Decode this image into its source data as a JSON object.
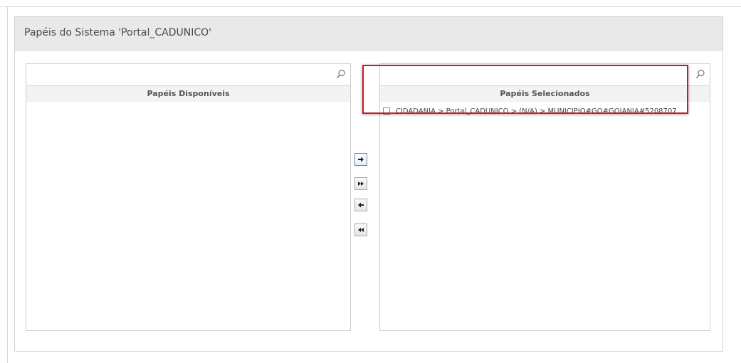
{
  "panel": {
    "title": "Papéis do Sistema 'Portal_CADUNICO'"
  },
  "available": {
    "search_value": "",
    "search_icon": "search-icon",
    "header": "Papéis Disponíveis",
    "items": []
  },
  "selected": {
    "search_value": "",
    "search_icon": "search-icon",
    "header": "Papéis Selecionados",
    "items": [
      {
        "label": "CIDADANIA > Portal_CADUNICO > (N/A) > MUNICIPIO#GO#GOIANIA#5208707",
        "checked": false
      }
    ]
  },
  "controls": {
    "add_icon": "arrow-right-icon",
    "add_all_icon": "double-arrow-right-icon",
    "remove_icon": "arrow-left-icon",
    "remove_all_icon": "double-arrow-left-icon"
  },
  "colors": {
    "highlight": "#c0202a",
    "header_bg": "#e9e9e9"
  }
}
